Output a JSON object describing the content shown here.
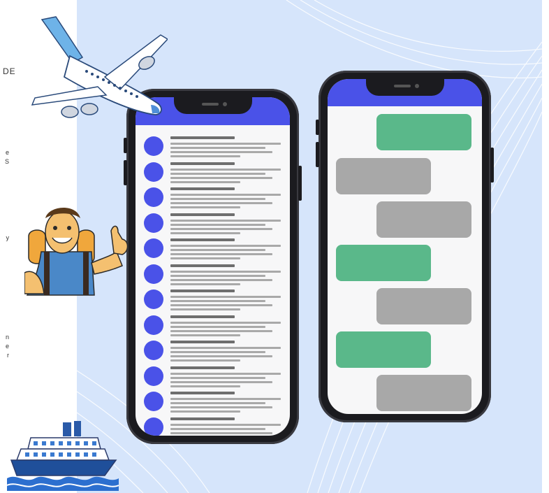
{
  "edge_text": {
    "top": "DE",
    "line1a": "e",
    "line1b": "S",
    "line2": "y",
    "line3a": "n",
    "line3b": "e",
    "line3c": "r"
  },
  "colors": {
    "background_panel": "#d6e5fb",
    "phone_frame": "#1b1b1f",
    "header_accent": "#4a52e8",
    "bubble_green": "#5ab88a",
    "bubble_gray": "#a8a8a8"
  },
  "left_phone": {
    "avatar_count": 12,
    "avatar_icon": "user-avatar"
  },
  "right_phone": {
    "bubbles": [
      "outgoing",
      "incoming",
      "outgoing",
      "incoming",
      "outgoing",
      "incoming",
      "outgoing"
    ]
  },
  "illustrations": [
    "airplane-icon",
    "backpacker-icon",
    "cruise-ship-icon"
  ]
}
